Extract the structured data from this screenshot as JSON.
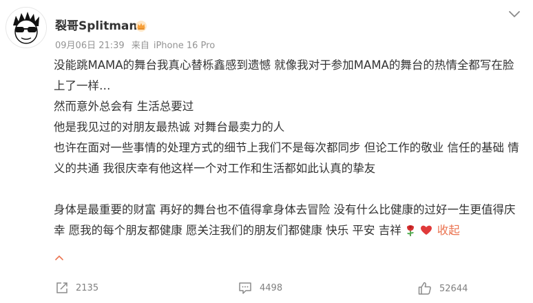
{
  "post": {
    "author": "裂哥Splitman",
    "date": "09月06日 21:39",
    "source_prefix": "来自",
    "device": "iPhone 16 Pro",
    "paragraphs": [
      "没能跳MAMA的舞台我真心替栎鑫感到遗憾 就像我对于参加MAMA的舞台的热情全都写在脸上了一样…",
      "然而意外总会有 生活总要过",
      "他是我见过的对朋友最热诚 对舞台最卖力的人",
      "也许在面对一些事情的处理方式的细节上我们不是每次都同步 但论工作的敬业 信任的基础 情义的共通 我很庆幸有他这样一个对工作和生活都如此认真的挚友"
    ],
    "last_paragraph": "身体是最重要的财富 再好的舞台也不值得拿身体去冒险 没有什么比健康的过好一生更值得庆幸 愿我的每个朋友都健康 愿关注我们的朋友们都健康 快乐 平安 吉祥",
    "collapse_label": "收起"
  },
  "actions": {
    "repost_count": "2135",
    "comment_count": "4498",
    "like_count": "52644"
  },
  "icons": {
    "badge": "crown-icon",
    "more": "chevron-down-icon",
    "caret": "chevron-up-icon",
    "repost": "share-icon",
    "comment": "comment-icon",
    "like": "thumbs-up-icon",
    "rose": "rose-icon",
    "heart": "heart-icon"
  },
  "colors": {
    "accent": "#eb7350",
    "meta": "#939393",
    "text": "#333333",
    "heart": "#e03a3a"
  }
}
